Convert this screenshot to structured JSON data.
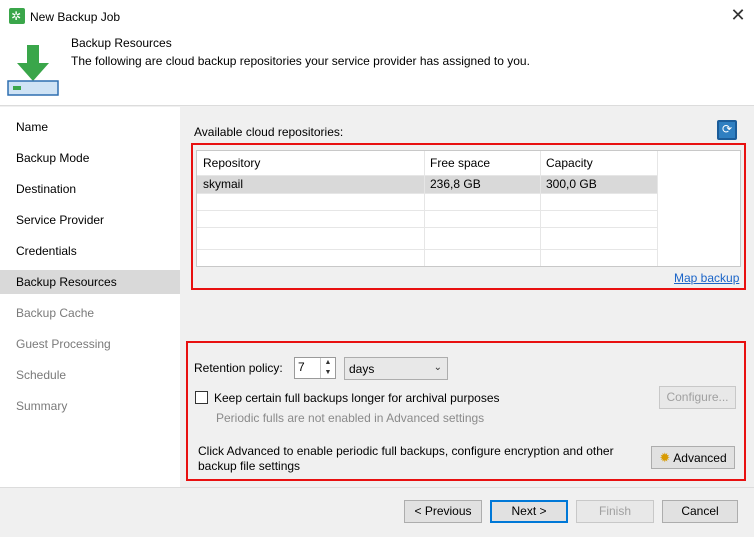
{
  "window": {
    "title": "New Backup Job",
    "close_glyph": "✕"
  },
  "header": {
    "title": "Backup Resources",
    "subtitle": "The following are cloud backup repositories your service provider has assigned to you."
  },
  "nav": {
    "items": [
      {
        "label": "Name"
      },
      {
        "label": "Backup Mode"
      },
      {
        "label": "Destination"
      },
      {
        "label": "Service Provider"
      },
      {
        "label": "Credentials"
      },
      {
        "label": "Backup Resources"
      },
      {
        "label": "Backup Cache"
      },
      {
        "label": "Guest Processing"
      },
      {
        "label": "Schedule"
      },
      {
        "label": "Summary"
      }
    ],
    "active_index": 5
  },
  "repositories": {
    "label": "Available cloud repositories:",
    "refresh_icon": "refresh-icon",
    "columns": [
      "Repository",
      "Free space",
      "Capacity"
    ],
    "rows": [
      {
        "repository": "skymail",
        "free_space": "236,8 GB",
        "capacity": "300,0 GB"
      }
    ],
    "map_link": "Map backup"
  },
  "retention": {
    "label": "Retention policy:",
    "value": "7",
    "unit": "days"
  },
  "archival": {
    "checkbox_label": "Keep certain full backups longer for archival purposes",
    "checked": false,
    "hint": "Periodic fulls are not enabled in Advanced settings",
    "configure_label": "Configure..."
  },
  "advanced": {
    "text": "Click Advanced to enable periodic full backups, configure encryption and other backup file settings",
    "button_label": "Advanced",
    "icon": "gear-icon"
  },
  "footer": {
    "previous": "< Previous",
    "next": "Next >",
    "finish": "Finish",
    "cancel": "Cancel"
  },
  "colors": {
    "highlight_border": "#e81010",
    "link": "#1a64c8",
    "selection": "#d9d9d9"
  }
}
